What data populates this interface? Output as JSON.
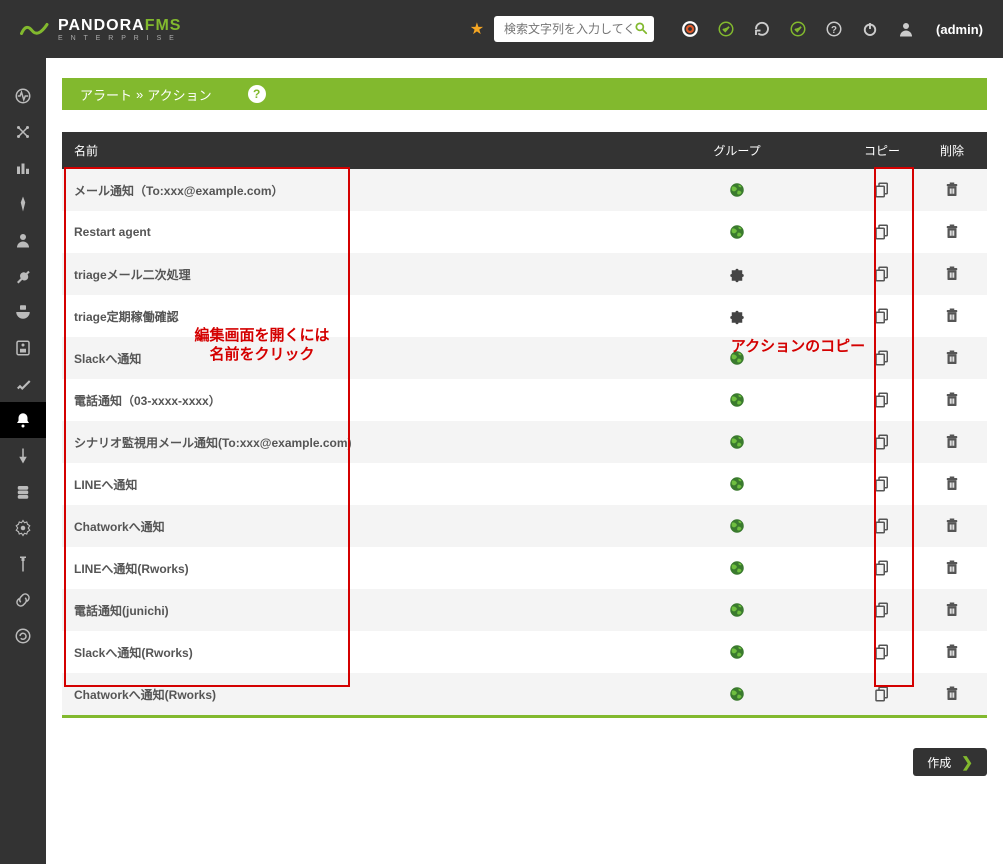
{
  "header": {
    "brand_main": "PANDORA",
    "brand_suffix": "FMS",
    "brand_sub": "E N T E R P R I S E",
    "search_placeholder": "検索文字列を入力してください",
    "user_label": "(admin)"
  },
  "breadcrumb": {
    "section": "アラート",
    "separator": "»",
    "page": "アクション"
  },
  "table": {
    "headers": {
      "name": "名前",
      "group": "グループ",
      "copy": "コピー",
      "delete": "削除"
    },
    "rows": [
      {
        "name": "メール通知（To:xxx@example.com）",
        "group": "world"
      },
      {
        "name": "Restart agent",
        "group": "world"
      },
      {
        "name": "triageメール二次処理",
        "group": "puzzle"
      },
      {
        "name": "triage定期稼働確認",
        "group": "puzzle"
      },
      {
        "name": "Slackへ通知",
        "group": "world"
      },
      {
        "name": "電話通知（03-xxxx-xxxx）",
        "group": "world"
      },
      {
        "name": "シナリオ監視用メール通知(To:xxx@example.com)",
        "group": "world"
      },
      {
        "name": "LINEへ通知",
        "group": "world"
      },
      {
        "name": "Chatworkへ通知",
        "group": "world"
      },
      {
        "name": "LINEへ通知(Rworks)",
        "group": "world"
      },
      {
        "name": "電話通知(junichi)",
        "group": "world"
      },
      {
        "name": "Slackへ通知(Rworks)",
        "group": "world"
      },
      {
        "name": "Chatworkへ通知(Rworks)",
        "group": "world"
      }
    ]
  },
  "annotations": {
    "name_hint_line1": "編集画面を開くには",
    "name_hint_line2": "名前をクリック",
    "copy_hint": "アクションのコピー"
  },
  "buttons": {
    "create": "作成"
  }
}
